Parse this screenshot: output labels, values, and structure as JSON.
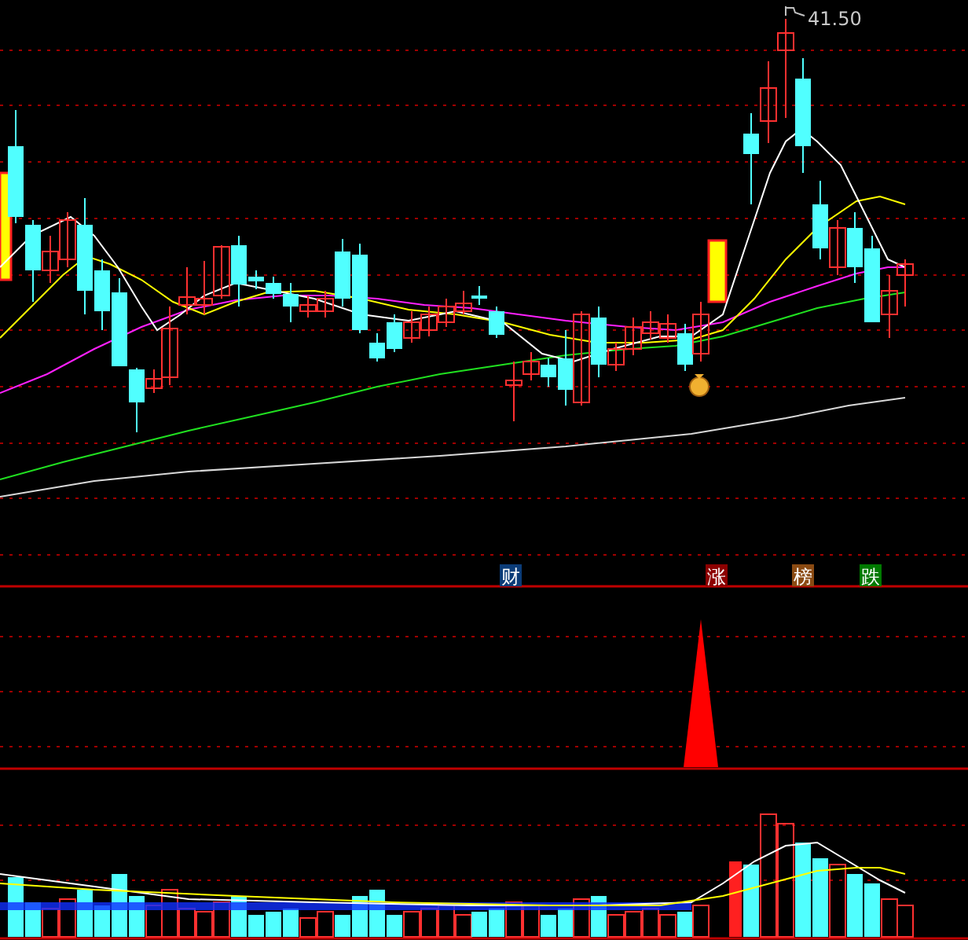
{
  "price_chart": {
    "high_label": "41.50"
  },
  "signals": [
    {
      "label": "财",
      "color": "#0b3c78"
    },
    {
      "label": "涨",
      "color": "#8c0000"
    },
    {
      "label": "榜",
      "color": "#8a4a12"
    },
    {
      "label": "跌",
      "color": "#007a00"
    }
  ]
}
